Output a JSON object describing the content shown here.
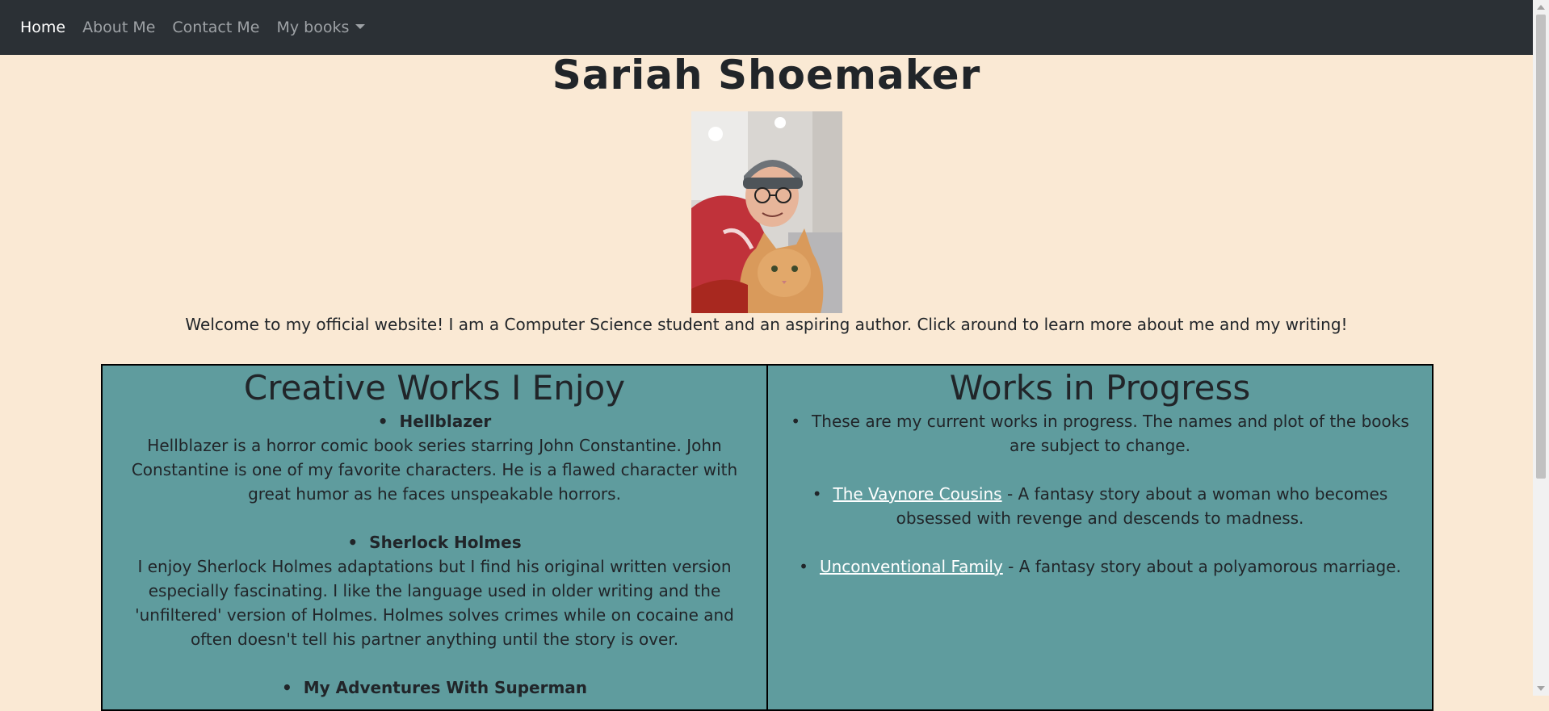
{
  "nav": {
    "items": [
      {
        "label": "Home",
        "active": true
      },
      {
        "label": "About Me",
        "active": false
      },
      {
        "label": "Contact Me",
        "active": false
      },
      {
        "label": "My books",
        "active": false,
        "dropdown": true
      }
    ]
  },
  "header": {
    "title": "Sariah Shoemaker",
    "welcome": "Welcome to my official website! I am a Computer Science student and an aspiring author. Click around to learn more about me and my writing!"
  },
  "enjoy": {
    "heading": "Creative Works I Enjoy",
    "items": [
      {
        "title": "Hellblazer",
        "desc": "Hellblazer is a horror comic book series starring John Constantine. John Constantine is one of my favorite characters. He is a flawed character with great humor as he faces unspeakable horrors."
      },
      {
        "title": "Sherlock Holmes",
        "desc": "I enjoy Sherlock Holmes adaptations but I find his original written version especially fascinating. I like the language used in older writing and the 'unfiltered' version of Holmes. Holmes solves crimes while on cocaine and often doesn't tell his partner anything until the story is over."
      },
      {
        "title": "My Adventures With Superman",
        "desc": ""
      }
    ]
  },
  "progress": {
    "heading": "Works in Progress",
    "intro": "These are my current works in progress. The names and plot of the books are subject to change.",
    "books": [
      {
        "link": "The Vaynore Cousins",
        "desc": " - A fantasy story about a woman who becomes obsessed with revenge and descends to madness."
      },
      {
        "link": "Unconventional Family",
        "desc": " - A fantasy story about a polyamorous marriage."
      }
    ]
  },
  "colors": {
    "navbar": "#2b3035",
    "page_bg": "#fae9d4",
    "panel_bg": "#5f9c9e"
  },
  "icons": [
    "dropdown-caret-icon"
  ]
}
